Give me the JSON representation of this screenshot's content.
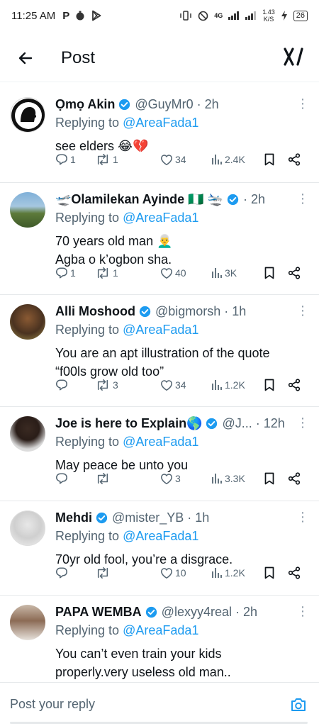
{
  "status_bar": {
    "time": "11:25 AM",
    "left_icons": [
      "P",
      "timer-icon",
      "play-store-icon"
    ],
    "network": "4G",
    "speed_value": "1.43",
    "speed_unit": "K/S",
    "battery": "26"
  },
  "header": {
    "title": "Post",
    "back_icon": "arrow-left-icon",
    "logo_icon": "x-grok-icon"
  },
  "replies": [
    {
      "name": "Ọmọ Akin",
      "handle": "@GuyMr0 · 2h",
      "replying_prefix": "Replying to ",
      "replying_to": "@AreaFada1",
      "text": [
        "see elders 😂💔"
      ],
      "reply_count": "1",
      "repost_count": "1",
      "like_count": "34",
      "views": "2.4K"
    },
    {
      "name": "🛫Olamilekan Ayinde 🇳🇬 🛬",
      "handle": "· 2h",
      "replying_prefix": "Replying to ",
      "replying_to": "@AreaFada1",
      "text": [
        "70 years old man 👨‍🦳",
        "Agba o k’ogbon sha."
      ],
      "reply_count": "1",
      "repost_count": "1",
      "like_count": "40",
      "views": "3K"
    },
    {
      "name": "Alli Moshood",
      "handle": "@bigmorsh · 1h",
      "replying_prefix": "Replying to ",
      "replying_to": "@AreaFada1",
      "text": [
        "You are an apt illustration of the quote",
        "“f00ls grow old too”"
      ],
      "reply_count": "",
      "repost_count": "3",
      "like_count": "34",
      "views": "1.2K"
    },
    {
      "name": "Joe is here to Explain🌎",
      "handle": "@J... · 12h",
      "replying_prefix": "Replying to ",
      "replying_to": "@AreaFada1",
      "text": [
        "May peace be unto you"
      ],
      "reply_count": "",
      "repost_count": "",
      "like_count": "3",
      "views": "3.3K"
    },
    {
      "name": "Mehdi",
      "handle": "@mister_YB · 1h",
      "replying_prefix": "Replying to ",
      "replying_to": "@AreaFada1",
      "text": [
        "70yr old fool, you’re a disgrace."
      ],
      "reply_count": "",
      "repost_count": "",
      "like_count": "10",
      "views": "1.2K"
    },
    {
      "name": "PAPA WEMBA",
      "handle": "@lexyy4real · 2h",
      "replying_prefix": "Replying to ",
      "replying_to": "@AreaFada1",
      "text": [
        "You can’t even train your kids",
        "properly.very useless old man.."
      ],
      "reply_count": "",
      "repost_count": "",
      "like_count": "",
      "views": ""
    }
  ],
  "reply_bar": {
    "placeholder": "Post your reply",
    "camera_icon": "camera-icon"
  },
  "colors": {
    "accent": "#1d9bf0",
    "secondary_text": "#536471",
    "primary_text": "#0f1419",
    "divider": "#e6e9eb"
  }
}
